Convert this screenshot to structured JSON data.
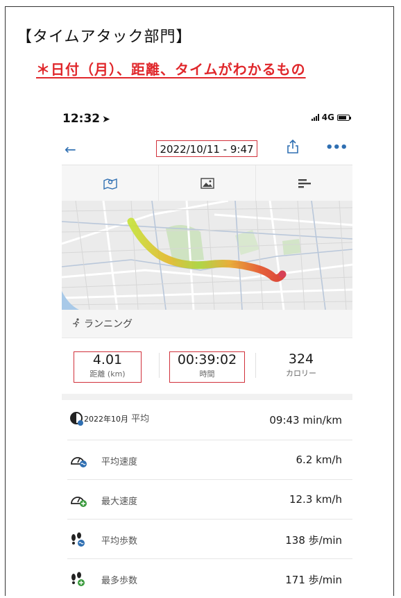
{
  "heading": "【タイムアタック部門】",
  "subheading": "＊日付（月）、距離、タイムがわかるもの",
  "status": {
    "time": "12:32",
    "network": "4G"
  },
  "nav": {
    "date": "2022/10/11 - 9:47"
  },
  "activity_type": "ランニング",
  "metrics": [
    {
      "value": "4.01",
      "label": "距離 (km)"
    },
    {
      "value": "00:39:02",
      "label": "時間"
    },
    {
      "value": "324",
      "label": "カロリー"
    }
  ],
  "stats": [
    {
      "label_prefix": "2022年10月",
      "label": "平均",
      "value": "09:43 min/km"
    },
    {
      "label": "平均速度",
      "value": "6.2 km/h"
    },
    {
      "label": "最大速度",
      "value": "12.3 km/h"
    },
    {
      "label": "平均歩数",
      "value": "138 歩/min"
    },
    {
      "label": "最多歩数",
      "value": "171 歩/min"
    }
  ],
  "colors": {
    "accent": "#2f6fb2",
    "highlight_box": "#d1303a",
    "heading_red": "#e0272b"
  }
}
